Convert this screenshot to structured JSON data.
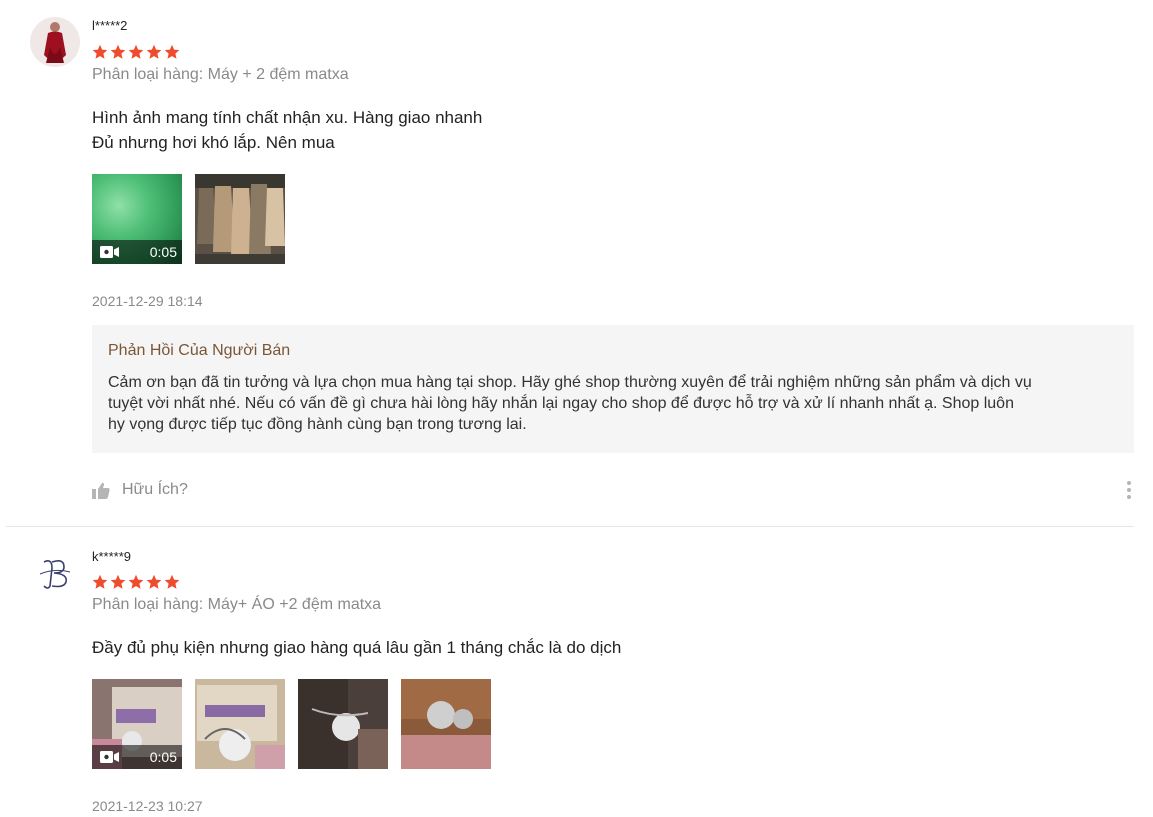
{
  "reviews": [
    {
      "username": "l*****2",
      "rating": 5,
      "variant": "Phân loại hàng: Máy + 2 đệm matxa",
      "content_lines": [
        "Hình ảnh mang tính chất nhận xu. Hàng giao nhanh",
        "Đủ nhưng hơi khó lắp. Nên mua"
      ],
      "video_duration": "0:05",
      "timestamp": "2021-12-29 18:14",
      "seller_reply": {
        "title": "Phản Hồi Của Người Bán",
        "lines": [
          "Cảm ơn bạn đã tin tưởng và lựa chọn mua hàng tại shop. Hãy ghé shop thường xuyên để trải nghiệm những sản phẩm và dịch vụ",
          "tuyệt vời nhất nhé. Nếu có vấn đề gì chưa hài lòng hãy nhắn lại ngay cho shop để được hỗ trợ và xử lí nhanh nhất ạ. Shop luôn",
          "hy vọng được tiếp tục đồng hành cùng bạn trong tương lai."
        ]
      },
      "helpful_label": "Hữu Ích?"
    },
    {
      "username": "k*****9",
      "rating": 5,
      "variant": "Phân loại hàng: Máy+ ÁO +2 đệm matxa",
      "content_lines": [
        "Đầy đủ phụ kiện nhưng giao hàng quá lâu gần 1 tháng chắc là do dịch"
      ],
      "video_duration": "0:05",
      "timestamp": "2021-12-23 10:27"
    }
  ],
  "colors": {
    "star": "#ee4d2d",
    "reply_title": "#7b5636",
    "muted": "#8a8a8a"
  },
  "icons": {
    "star": "star-icon",
    "video": "video-camera-icon",
    "thumbs_up": "thumbs-up-icon",
    "more": "more-vertical-icon"
  }
}
